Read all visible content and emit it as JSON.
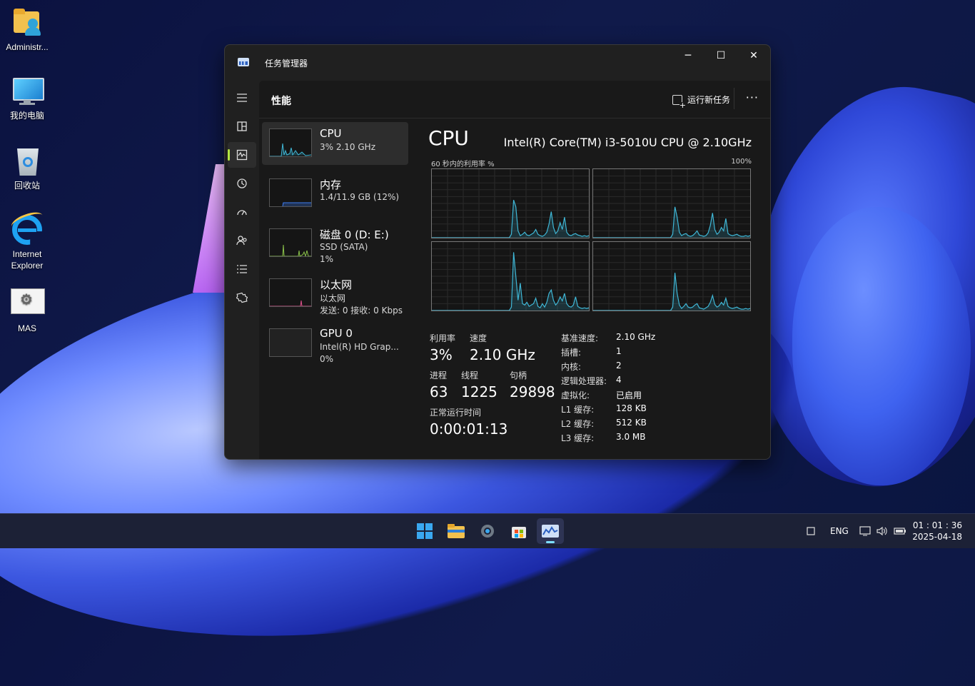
{
  "desktop": {
    "icons": [
      {
        "label": "Administr...",
        "icon": "user-folder-icon"
      },
      {
        "label": "我的电脑",
        "icon": "monitor-icon"
      },
      {
        "label": "回收站",
        "icon": "recycle-bin-icon"
      },
      {
        "label": "Internet Explorer",
        "icon": "internet-explorer-icon"
      },
      {
        "label": "MAS",
        "icon": "gear-shortcut-icon"
      }
    ]
  },
  "window": {
    "title": "任务管理器",
    "minimize": "─",
    "maximize": "☐",
    "close": "✕"
  },
  "nav": {
    "items": [
      "menu-icon",
      "processes-icon",
      "performance-icon",
      "app-history-icon",
      "startup-icon",
      "users-icon",
      "details-icon",
      "services-icon"
    ],
    "bottom": "settings-icon",
    "accent": "#b4e642"
  },
  "header": {
    "page_title": "性能",
    "run_task": "运行新任务",
    "more": "···"
  },
  "perf_list": [
    {
      "name": "CPU",
      "line1": "3% 2.10 GHz",
      "line2": "",
      "color": "#3fb7d6"
    },
    {
      "name": "内存",
      "line1": "1.4/11.9 GB (12%)",
      "line2": "",
      "color": "#3d7cf0"
    },
    {
      "name": "磁盘 0 (D: E:)",
      "line1": "SSD (SATA)",
      "line2": "1%",
      "color": "#8bc34a"
    },
    {
      "name": "以太网",
      "line1": "以太网",
      "line2": "发送: 0  接收: 0 Kbps",
      "color": "#e0518c"
    },
    {
      "name": "GPU 0",
      "line1": "Intel(R) HD Grap...",
      "line2": "0%",
      "color": "#3fb7d6"
    }
  ],
  "cpu": {
    "title": "CPU",
    "model": "Intel(R) Core(TM) i3-5010U CPU @ 2.10GHz",
    "graph_label": "60 秒内的利用率 %",
    "graph_max": "100%",
    "utilization_label": "利用率",
    "utilization": "3%",
    "speed_label": "速度",
    "speed": "2.10 GHz",
    "processes_label": "进程",
    "processes": "63",
    "threads_label": "线程",
    "threads": "1225",
    "handles_label": "句柄",
    "handles": "29898",
    "uptime_label": "正常运行时间",
    "uptime": "0:00:01:13",
    "specs": [
      {
        "k": "基准速度:",
        "v": "2.10 GHz"
      },
      {
        "k": "插槽:",
        "v": "1"
      },
      {
        "k": "内核:",
        "v": "2"
      },
      {
        "k": "逻辑处理器:",
        "v": "4"
      },
      {
        "k": "虚拟化:",
        "v": "已启用"
      },
      {
        "k": "L1 缓存:",
        "v": "128 KB"
      },
      {
        "k": "L2 缓存:",
        "v": "512 KB"
      },
      {
        "k": "L3 缓存:",
        "v": "3.0 MB"
      }
    ],
    "core_series": [
      [
        0,
        0,
        0,
        0,
        0,
        0,
        0,
        0,
        0,
        0,
        0,
        0,
        0,
        0,
        0,
        0,
        0,
        0,
        0,
        0,
        0,
        0,
        0,
        0,
        0,
        0,
        0,
        0,
        0,
        0,
        0,
        0,
        0,
        0,
        0,
        0,
        5,
        55,
        45,
        10,
        3,
        5,
        8,
        4,
        3,
        5,
        7,
        12,
        5,
        3,
        2,
        4,
        8,
        20,
        38,
        15,
        6,
        10,
        22,
        12,
        30,
        8,
        4,
        3,
        5,
        6,
        4,
        3,
        2,
        3,
        2,
        3
      ],
      [
        0,
        0,
        0,
        0,
        0,
        0,
        0,
        0,
        0,
        0,
        0,
        0,
        0,
        0,
        0,
        0,
        0,
        0,
        0,
        0,
        0,
        0,
        0,
        0,
        0,
        0,
        0,
        0,
        0,
        0,
        0,
        0,
        0,
        0,
        0,
        0,
        5,
        45,
        30,
        8,
        3,
        5,
        6,
        3,
        2,
        3,
        6,
        10,
        4,
        3,
        2,
        3,
        7,
        18,
        36,
        12,
        5,
        8,
        15,
        10,
        28,
        6,
        4,
        3,
        4,
        5,
        3,
        2,
        2,
        3,
        2,
        3
      ],
      [
        0,
        0,
        0,
        0,
        0,
        0,
        0,
        0,
        0,
        0,
        0,
        0,
        0,
        0,
        0,
        0,
        0,
        0,
        0,
        0,
        0,
        0,
        0,
        0,
        0,
        0,
        0,
        0,
        0,
        0,
        0,
        0,
        0,
        0,
        0,
        0,
        5,
        85,
        50,
        15,
        40,
        10,
        8,
        12,
        6,
        8,
        10,
        18,
        6,
        4,
        10,
        5,
        12,
        25,
        30,
        15,
        8,
        12,
        20,
        14,
        25,
        10,
        6,
        5,
        8,
        20,
        6,
        4,
        3,
        4,
        3,
        4
      ],
      [
        0,
        0,
        0,
        0,
        0,
        0,
        0,
        0,
        0,
        0,
        0,
        0,
        0,
        0,
        0,
        0,
        0,
        0,
        0,
        0,
        0,
        0,
        0,
        0,
        0,
        0,
        0,
        0,
        0,
        0,
        0,
        0,
        0,
        0,
        0,
        0,
        5,
        55,
        25,
        8,
        3,
        6,
        10,
        5,
        4,
        5,
        8,
        10,
        4,
        3,
        2,
        4,
        6,
        12,
        22,
        9,
        5,
        7,
        12,
        8,
        18,
        6,
        4,
        3,
        4,
        5,
        3,
        2,
        2,
        3,
        2,
        3
      ]
    ]
  },
  "taskbar": {
    "apps": [
      "windows-start-icon",
      "file-explorer-icon",
      "settings-icon",
      "store-icon",
      "task-manager-icon"
    ],
    "lang": "ENG",
    "time": "01 : 01 : 36",
    "date": "2025-04-18"
  }
}
